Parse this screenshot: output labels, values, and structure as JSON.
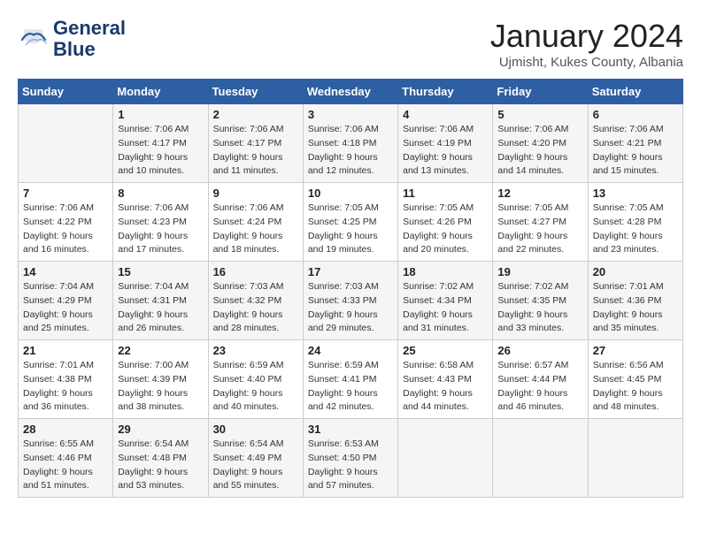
{
  "header": {
    "logo_line1": "General",
    "logo_line2": "Blue",
    "month": "January 2024",
    "location": "Ujmisht, Kukes County, Albania"
  },
  "weekdays": [
    "Sunday",
    "Monday",
    "Tuesday",
    "Wednesday",
    "Thursday",
    "Friday",
    "Saturday"
  ],
  "weeks": [
    [
      {
        "day": "",
        "info": ""
      },
      {
        "day": "1",
        "info": "Sunrise: 7:06 AM\nSunset: 4:17 PM\nDaylight: 9 hours\nand 10 minutes."
      },
      {
        "day": "2",
        "info": "Sunrise: 7:06 AM\nSunset: 4:17 PM\nDaylight: 9 hours\nand 11 minutes."
      },
      {
        "day": "3",
        "info": "Sunrise: 7:06 AM\nSunset: 4:18 PM\nDaylight: 9 hours\nand 12 minutes."
      },
      {
        "day": "4",
        "info": "Sunrise: 7:06 AM\nSunset: 4:19 PM\nDaylight: 9 hours\nand 13 minutes."
      },
      {
        "day": "5",
        "info": "Sunrise: 7:06 AM\nSunset: 4:20 PM\nDaylight: 9 hours\nand 14 minutes."
      },
      {
        "day": "6",
        "info": "Sunrise: 7:06 AM\nSunset: 4:21 PM\nDaylight: 9 hours\nand 15 minutes."
      }
    ],
    [
      {
        "day": "7",
        "info": "Sunrise: 7:06 AM\nSunset: 4:22 PM\nDaylight: 9 hours\nand 16 minutes."
      },
      {
        "day": "8",
        "info": "Sunrise: 7:06 AM\nSunset: 4:23 PM\nDaylight: 9 hours\nand 17 minutes."
      },
      {
        "day": "9",
        "info": "Sunrise: 7:06 AM\nSunset: 4:24 PM\nDaylight: 9 hours\nand 18 minutes."
      },
      {
        "day": "10",
        "info": "Sunrise: 7:05 AM\nSunset: 4:25 PM\nDaylight: 9 hours\nand 19 minutes."
      },
      {
        "day": "11",
        "info": "Sunrise: 7:05 AM\nSunset: 4:26 PM\nDaylight: 9 hours\nand 20 minutes."
      },
      {
        "day": "12",
        "info": "Sunrise: 7:05 AM\nSunset: 4:27 PM\nDaylight: 9 hours\nand 22 minutes."
      },
      {
        "day": "13",
        "info": "Sunrise: 7:05 AM\nSunset: 4:28 PM\nDaylight: 9 hours\nand 23 minutes."
      }
    ],
    [
      {
        "day": "14",
        "info": "Sunrise: 7:04 AM\nSunset: 4:29 PM\nDaylight: 9 hours\nand 25 minutes."
      },
      {
        "day": "15",
        "info": "Sunrise: 7:04 AM\nSunset: 4:31 PM\nDaylight: 9 hours\nand 26 minutes."
      },
      {
        "day": "16",
        "info": "Sunrise: 7:03 AM\nSunset: 4:32 PM\nDaylight: 9 hours\nand 28 minutes."
      },
      {
        "day": "17",
        "info": "Sunrise: 7:03 AM\nSunset: 4:33 PM\nDaylight: 9 hours\nand 29 minutes."
      },
      {
        "day": "18",
        "info": "Sunrise: 7:02 AM\nSunset: 4:34 PM\nDaylight: 9 hours\nand 31 minutes."
      },
      {
        "day": "19",
        "info": "Sunrise: 7:02 AM\nSunset: 4:35 PM\nDaylight: 9 hours\nand 33 minutes."
      },
      {
        "day": "20",
        "info": "Sunrise: 7:01 AM\nSunset: 4:36 PM\nDaylight: 9 hours\nand 35 minutes."
      }
    ],
    [
      {
        "day": "21",
        "info": "Sunrise: 7:01 AM\nSunset: 4:38 PM\nDaylight: 9 hours\nand 36 minutes."
      },
      {
        "day": "22",
        "info": "Sunrise: 7:00 AM\nSunset: 4:39 PM\nDaylight: 9 hours\nand 38 minutes."
      },
      {
        "day": "23",
        "info": "Sunrise: 6:59 AM\nSunset: 4:40 PM\nDaylight: 9 hours\nand 40 minutes."
      },
      {
        "day": "24",
        "info": "Sunrise: 6:59 AM\nSunset: 4:41 PM\nDaylight: 9 hours\nand 42 minutes."
      },
      {
        "day": "25",
        "info": "Sunrise: 6:58 AM\nSunset: 4:43 PM\nDaylight: 9 hours\nand 44 minutes."
      },
      {
        "day": "26",
        "info": "Sunrise: 6:57 AM\nSunset: 4:44 PM\nDaylight: 9 hours\nand 46 minutes."
      },
      {
        "day": "27",
        "info": "Sunrise: 6:56 AM\nSunset: 4:45 PM\nDaylight: 9 hours\nand 48 minutes."
      }
    ],
    [
      {
        "day": "28",
        "info": "Sunrise: 6:55 AM\nSunset: 4:46 PM\nDaylight: 9 hours\nand 51 minutes."
      },
      {
        "day": "29",
        "info": "Sunrise: 6:54 AM\nSunset: 4:48 PM\nDaylight: 9 hours\nand 53 minutes."
      },
      {
        "day": "30",
        "info": "Sunrise: 6:54 AM\nSunset: 4:49 PM\nDaylight: 9 hours\nand 55 minutes."
      },
      {
        "day": "31",
        "info": "Sunrise: 6:53 AM\nSunset: 4:50 PM\nDaylight: 9 hours\nand 57 minutes."
      },
      {
        "day": "",
        "info": ""
      },
      {
        "day": "",
        "info": ""
      },
      {
        "day": "",
        "info": ""
      }
    ]
  ]
}
